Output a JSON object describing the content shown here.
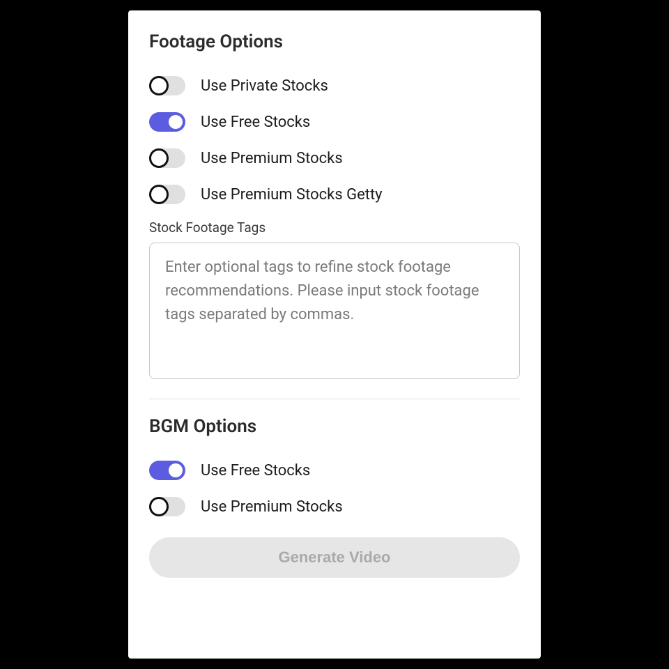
{
  "footage": {
    "title": "Footage Options",
    "toggles": [
      {
        "label": "Use Private Stocks",
        "on": false
      },
      {
        "label": "Use Free Stocks",
        "on": true
      },
      {
        "label": "Use Premium Stocks",
        "on": false
      },
      {
        "label": "Use Premium Stocks Getty",
        "on": false
      }
    ],
    "tags_label": "Stock Footage Tags",
    "tags_placeholder": "Enter optional tags to refine stock footage recommendations. Please input stock footage tags separated by commas.",
    "tags_value": ""
  },
  "bgm": {
    "title": "BGM Options",
    "toggles": [
      {
        "label": "Use Free Stocks",
        "on": true
      },
      {
        "label": "Use Premium Stocks",
        "on": false
      }
    ]
  },
  "generate_label": "Generate Video",
  "accent_color": "#5c5ce0"
}
